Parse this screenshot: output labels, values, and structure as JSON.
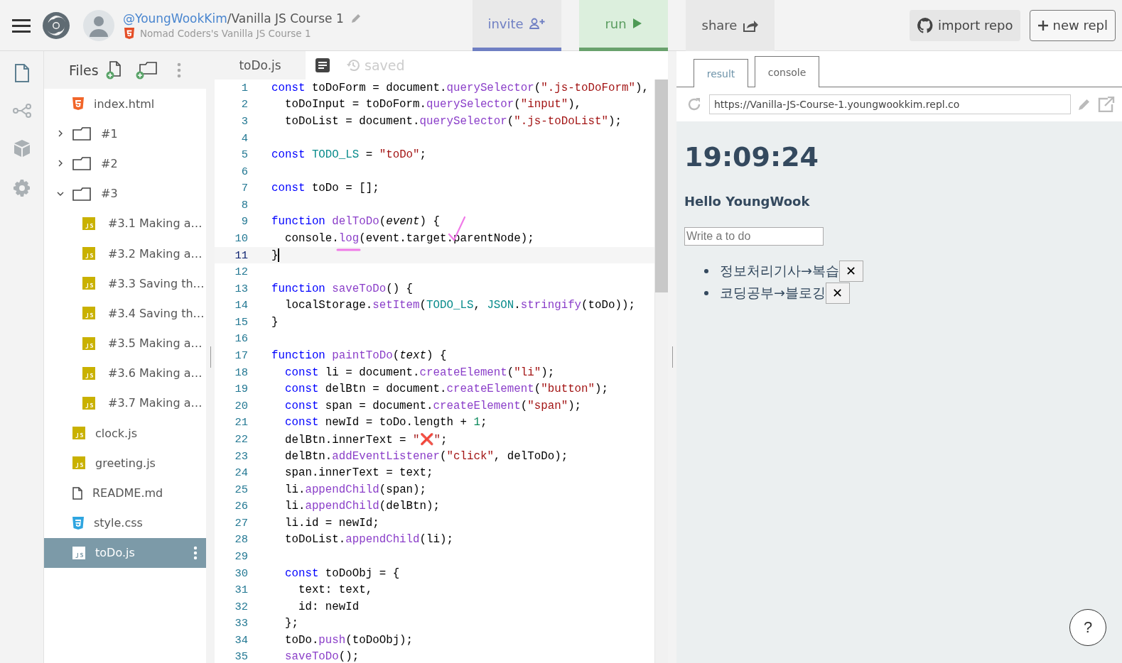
{
  "topbar": {
    "owner": "@YoungWookKim",
    "title": "/Vanilla JS Course 1",
    "subtitle": "Nomad Coders's Vanilla JS Course 1",
    "actions": [
      {
        "kind": "invite",
        "label": "invite"
      },
      {
        "kind": "run",
        "label": "run"
      },
      {
        "kind": "share",
        "label": "share"
      }
    ],
    "buttons": [
      {
        "kind": "github",
        "label": "import repo"
      },
      {
        "kind": "plus",
        "label": "new repl"
      }
    ]
  },
  "rail": [
    {
      "kind": "files",
      "selected": true
    },
    {
      "kind": "share",
      "selected": false
    },
    {
      "kind": "packages",
      "selected": false
    },
    {
      "kind": "settings",
      "selected": false
    }
  ],
  "files": {
    "title": "Files",
    "items": [
      {
        "kind": "html",
        "name": "index.html",
        "selected": false
      },
      {
        "kind": "folder",
        "name": "#1",
        "expanded": false,
        "selected": false
      },
      {
        "kind": "folder",
        "name": "#2",
        "expanded": false,
        "selected": false
      },
      {
        "kind": "folder",
        "name": "#3",
        "expanded": true,
        "selected": false,
        "children": [
          {
            "kind": "js",
            "name": "#3.1 Making a…",
            "selected": false
          },
          {
            "kind": "js",
            "name": "#3.2 Making a…",
            "selected": false
          },
          {
            "kind": "js",
            "name": "#3.3 Saving th…",
            "selected": false
          },
          {
            "kind": "js",
            "name": "#3.4 Saving th…",
            "selected": false
          },
          {
            "kind": "js",
            "name": "#3.5 Making a…",
            "selected": false
          },
          {
            "kind": "js",
            "name": "#3.6 Making a…",
            "selected": false
          },
          {
            "kind": "js",
            "name": "#3.7 Making a…",
            "selected": false
          }
        ]
      },
      {
        "kind": "js",
        "name": "clock.js",
        "selected": false
      },
      {
        "kind": "js",
        "name": "greeting.js",
        "selected": false
      },
      {
        "kind": "md",
        "name": "README.md",
        "selected": false
      },
      {
        "kind": "css",
        "name": "style.css",
        "selected": false
      },
      {
        "kind": "js",
        "name": "toDo.js",
        "selected": true
      }
    ]
  },
  "editor": {
    "tab": "toDo.js",
    "status": "saved",
    "lines": [
      {
        "n": "1",
        "current": false,
        "tokens": [
          {
            "kind": "kw",
            "text": "const"
          },
          {
            "kind": "p",
            "text": " toDoForm = document."
          },
          {
            "kind": "fn",
            "text": "querySelector"
          },
          {
            "kind": "p",
            "text": "("
          },
          {
            "kind": "str",
            "text": "\".js-toDoForm\""
          },
          {
            "kind": "p",
            "text": "),"
          }
        ]
      },
      {
        "n": "2",
        "current": false,
        "tokens": [
          {
            "kind": "p",
            "text": "  toDoInput = toDoForm."
          },
          {
            "kind": "fn",
            "text": "querySelector"
          },
          {
            "kind": "p",
            "text": "("
          },
          {
            "kind": "str",
            "text": "\"input\""
          },
          {
            "kind": "p",
            "text": "),"
          }
        ]
      },
      {
        "n": "3",
        "current": false,
        "tokens": [
          {
            "kind": "p",
            "text": "  toDoList = document."
          },
          {
            "kind": "fn",
            "text": "querySelector"
          },
          {
            "kind": "p",
            "text": "("
          },
          {
            "kind": "str",
            "text": "\".js-toDoList\""
          },
          {
            "kind": "p",
            "text": ");"
          }
        ]
      },
      {
        "n": "4",
        "current": false
      },
      {
        "n": "5",
        "current": false,
        "tokens": [
          {
            "kind": "kw",
            "text": "const"
          },
          {
            "kind": "var",
            "text": " TODO_LS"
          },
          {
            "kind": "p",
            "text": " = "
          },
          {
            "kind": "str",
            "text": "\"toDo\""
          },
          {
            "kind": "p",
            "text": ";"
          }
        ]
      },
      {
        "n": "6",
        "current": false
      },
      {
        "n": "7",
        "current": false,
        "tokens": [
          {
            "kind": "kw",
            "text": "const"
          },
          {
            "kind": "p",
            "text": " toDo = [];"
          }
        ]
      },
      {
        "n": "8",
        "current": false
      },
      {
        "n": "9",
        "current": false,
        "tokens": [
          {
            "kind": "kw",
            "text": "function"
          },
          {
            "kind": "fn",
            "text": " delToDo"
          },
          {
            "kind": "p",
            "text": "("
          },
          {
            "kind": "param",
            "text": "event"
          },
          {
            "kind": "p",
            "text": ") {"
          }
        ]
      },
      {
        "n": "10",
        "current": false,
        "tokens": [
          {
            "kind": "p",
            "text": "  console."
          },
          {
            "kind": "fn",
            "text": "log"
          },
          {
            "kind": "p",
            "text": "(event.target.parentNode);"
          }
        ]
      },
      {
        "n": "11",
        "current": true,
        "tokens": [
          {
            "kind": "p",
            "text": "}"
          }
        ]
      },
      {
        "n": "12",
        "current": false
      },
      {
        "n": "13",
        "current": false,
        "tokens": [
          {
            "kind": "kw",
            "text": "function"
          },
          {
            "kind": "fn",
            "text": " saveToDo"
          },
          {
            "kind": "p",
            "text": "() {"
          }
        ]
      },
      {
        "n": "14",
        "current": false,
        "tokens": [
          {
            "kind": "p",
            "text": "  localStorage."
          },
          {
            "kind": "fn",
            "text": "setItem"
          },
          {
            "kind": "p",
            "text": "("
          },
          {
            "kind": "var",
            "text": "TODO_LS"
          },
          {
            "kind": "p",
            "text": ", "
          },
          {
            "kind": "var",
            "text": "JSON"
          },
          {
            "kind": "p",
            "text": "."
          },
          {
            "kind": "fn",
            "text": "stringify"
          },
          {
            "kind": "p",
            "text": "(toDo));"
          }
        ]
      },
      {
        "n": "15",
        "current": false,
        "tokens": [
          {
            "kind": "p",
            "text": "}"
          }
        ]
      },
      {
        "n": "16",
        "current": false
      },
      {
        "n": "17",
        "current": false,
        "tokens": [
          {
            "kind": "kw",
            "text": "function"
          },
          {
            "kind": "fn",
            "text": " paintToDo"
          },
          {
            "kind": "p",
            "text": "("
          },
          {
            "kind": "param",
            "text": "text"
          },
          {
            "kind": "p",
            "text": ") {"
          }
        ]
      },
      {
        "n": "18",
        "current": false,
        "tokens": [
          {
            "kind": "kw",
            "text": "  const"
          },
          {
            "kind": "p",
            "text": " li = document."
          },
          {
            "kind": "fn",
            "text": "createElement"
          },
          {
            "kind": "p",
            "text": "("
          },
          {
            "kind": "str",
            "text": "\"li\""
          },
          {
            "kind": "p",
            "text": ");"
          }
        ]
      },
      {
        "n": "19",
        "current": false,
        "tokens": [
          {
            "kind": "kw",
            "text": "  const"
          },
          {
            "kind": "p",
            "text": " delBtn = document."
          },
          {
            "kind": "fn",
            "text": "createElement"
          },
          {
            "kind": "p",
            "text": "("
          },
          {
            "kind": "str",
            "text": "\"button\""
          },
          {
            "kind": "p",
            "text": ");"
          }
        ]
      },
      {
        "n": "20",
        "current": false,
        "tokens": [
          {
            "kind": "kw",
            "text": "  const"
          },
          {
            "kind": "p",
            "text": " span = document."
          },
          {
            "kind": "fn",
            "text": "createElement"
          },
          {
            "kind": "p",
            "text": "("
          },
          {
            "kind": "str",
            "text": "\"span\""
          },
          {
            "kind": "p",
            "text": ");"
          }
        ]
      },
      {
        "n": "21",
        "current": false,
        "tokens": [
          {
            "kind": "kw",
            "text": "  const"
          },
          {
            "kind": "p",
            "text": " newId = toDo.length + "
          },
          {
            "kind": "num",
            "text": "1"
          },
          {
            "kind": "p",
            "text": ";"
          }
        ]
      },
      {
        "n": "22",
        "current": false,
        "tokens": [
          {
            "kind": "p",
            "text": "  delBtn.innerText = "
          },
          {
            "kind": "str",
            "text": "\"❌\""
          },
          {
            "kind": "p",
            "text": ";"
          }
        ]
      },
      {
        "n": "23",
        "current": false,
        "tokens": [
          {
            "kind": "p",
            "text": "  delBtn."
          },
          {
            "kind": "fn",
            "text": "addEventListener"
          },
          {
            "kind": "p",
            "text": "("
          },
          {
            "kind": "str",
            "text": "\"click\""
          },
          {
            "kind": "p",
            "text": ", delToDo);"
          }
        ]
      },
      {
        "n": "24",
        "current": false,
        "tokens": [
          {
            "kind": "p",
            "text": "  span.innerText = text;"
          }
        ]
      },
      {
        "n": "25",
        "current": false,
        "tokens": [
          {
            "kind": "p",
            "text": "  li."
          },
          {
            "kind": "fn",
            "text": "appendChild"
          },
          {
            "kind": "p",
            "text": "(span);"
          }
        ]
      },
      {
        "n": "26",
        "current": false,
        "tokens": [
          {
            "kind": "p",
            "text": "  li."
          },
          {
            "kind": "fn",
            "text": "appendChild"
          },
          {
            "kind": "p",
            "text": "(delBtn);"
          }
        ]
      },
      {
        "n": "27",
        "current": false,
        "tokens": [
          {
            "kind": "p",
            "text": "  li.id = newId;"
          }
        ]
      },
      {
        "n": "28",
        "current": false,
        "tokens": [
          {
            "kind": "p",
            "text": "  toDoList."
          },
          {
            "kind": "fn",
            "text": "appendChild"
          },
          {
            "kind": "p",
            "text": "(li);"
          }
        ]
      },
      {
        "n": "29",
        "current": false
      },
      {
        "n": "30",
        "current": false,
        "tokens": [
          {
            "kind": "kw",
            "text": "  const"
          },
          {
            "kind": "p",
            "text": " toDoObj = {"
          }
        ]
      },
      {
        "n": "31",
        "current": false,
        "tokens": [
          {
            "kind": "p",
            "text": "    text: text,"
          }
        ]
      },
      {
        "n": "32",
        "current": false,
        "tokens": [
          {
            "kind": "p",
            "text": "    id: newId"
          }
        ]
      },
      {
        "n": "33",
        "current": false,
        "tokens": [
          {
            "kind": "p",
            "text": "  };"
          }
        ]
      },
      {
        "n": "34",
        "current": false,
        "tokens": [
          {
            "kind": "p",
            "text": "  toDo."
          },
          {
            "kind": "fn",
            "text": "push"
          },
          {
            "kind": "p",
            "text": "(toDoObj);"
          }
        ]
      },
      {
        "n": "35",
        "current": false,
        "tokens": [
          {
            "kind": "fn",
            "text": "  saveToDo"
          },
          {
            "kind": "p",
            "text": "();"
          }
        ]
      }
    ]
  },
  "output": {
    "tabs": [
      {
        "label": "result",
        "selected": true
      },
      {
        "label": "console",
        "selected": false
      }
    ],
    "url": "https://Vanilla-JS-Course-1.youngwookkim.repl.co",
    "clock": "19:09:24",
    "greeting": "Hello YoungWook",
    "input": {
      "placeholder": "Write a to do"
    },
    "todos": [
      {
        "text": "정보처리기사→복습",
        "button": "✕"
      },
      {
        "text": "코딩공부→블로깅",
        "button": "✕"
      }
    ],
    "help": "?"
  }
}
